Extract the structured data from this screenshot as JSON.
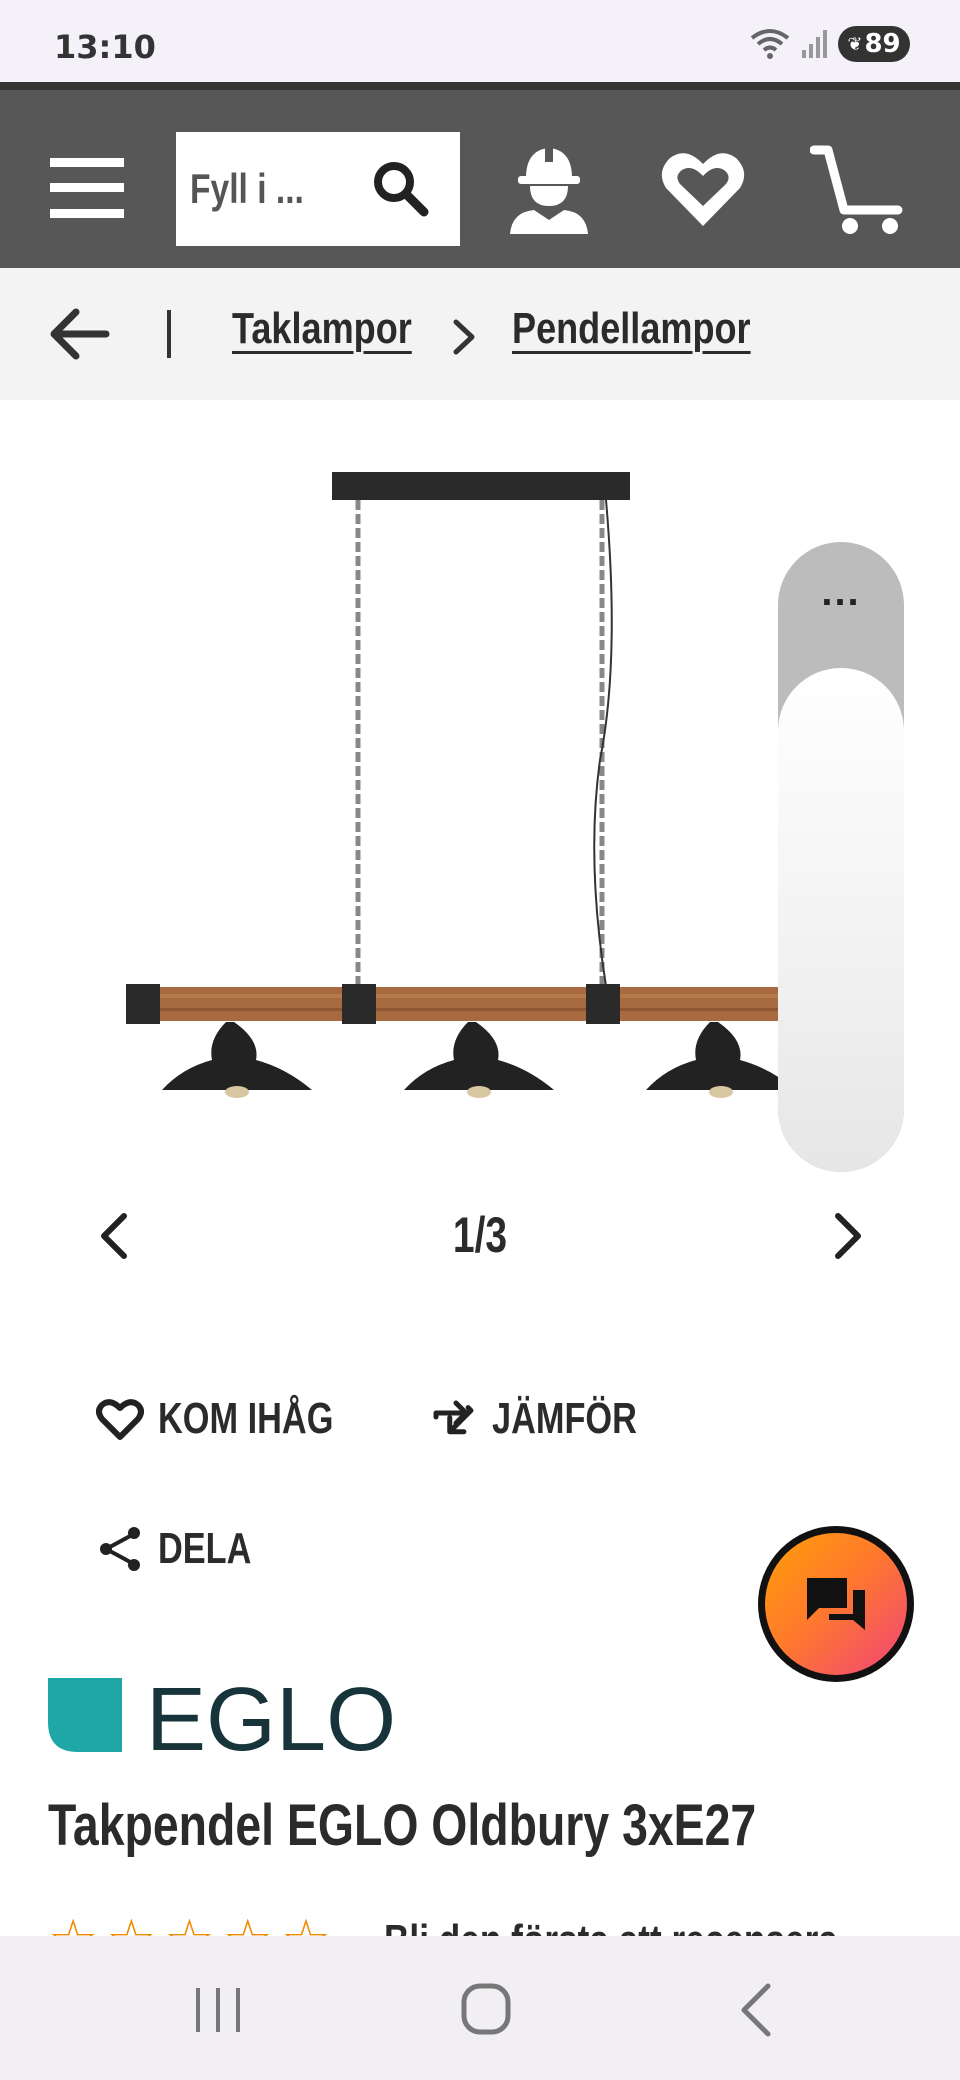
{
  "status_bar": {
    "time": "13:10",
    "battery": "89"
  },
  "header": {
    "search_placeholder": "Fyll i ..."
  },
  "breadcrumb": {
    "items": [
      "Taklampor",
      "Pendellampor"
    ]
  },
  "gallery": {
    "counter": "1/3",
    "more": "..."
  },
  "actions": {
    "remember": "KOM IHÅG",
    "compare": "JÄMFÖR",
    "share": "DELA"
  },
  "product": {
    "brand": "EGLO",
    "title": "Takpendel EGLO Oldbury 3xE27",
    "rating_stars": 0,
    "rating_max": 5,
    "review_prompt": "Bli den första att recensera"
  },
  "colors": {
    "header": "#575757",
    "accent": "#f08a00",
    "brand": "#1fa7a8",
    "brand_text": "#17343b"
  }
}
